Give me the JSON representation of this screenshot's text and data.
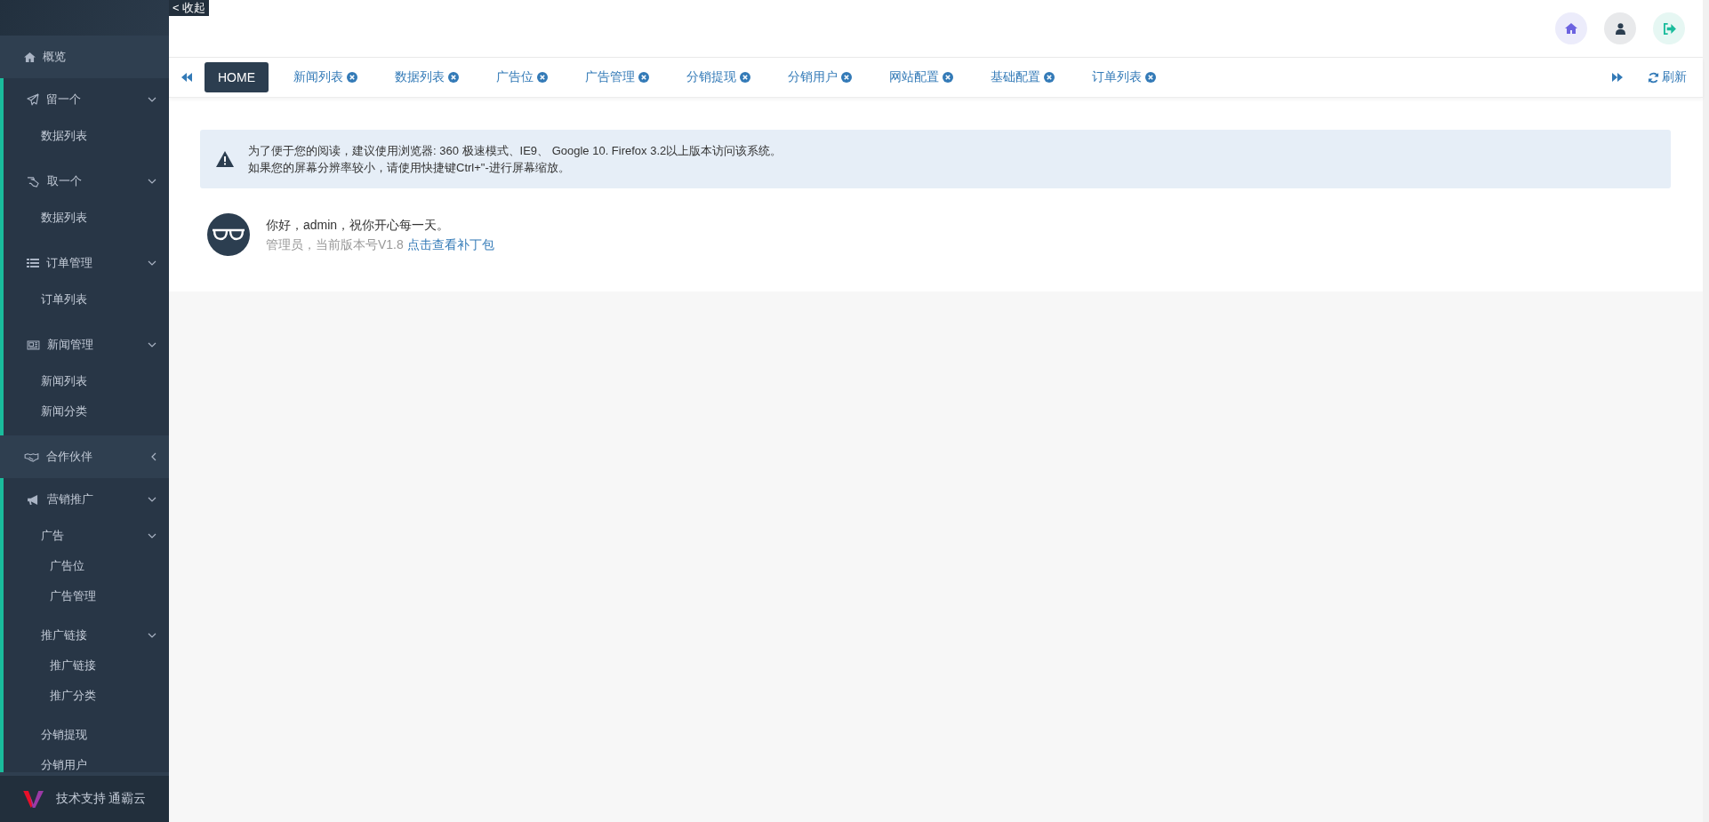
{
  "collapse_button": "< 收起",
  "sidebar": {
    "items": [
      {
        "label": "概览"
      },
      {
        "label": "留一个",
        "expanded": true,
        "children": [
          {
            "label": "数据列表"
          }
        ]
      },
      {
        "label": "取一个",
        "expanded": true,
        "children": [
          {
            "label": "数据列表"
          }
        ]
      },
      {
        "label": "订单管理",
        "expanded": true,
        "children": [
          {
            "label": "订单列表"
          }
        ]
      },
      {
        "label": "新闻管理",
        "expanded": true,
        "children": [
          {
            "label": "新闻列表"
          },
          {
            "label": "新闻分类"
          }
        ]
      },
      {
        "label": "合作伙伴",
        "expanded": false
      },
      {
        "label": "营销推广",
        "expanded": true,
        "children": [
          {
            "label": "广告",
            "expanded": true,
            "children": [
              {
                "label": "广告位"
              },
              {
                "label": "广告管理"
              }
            ]
          },
          {
            "label": "推广链接",
            "expanded": true,
            "children": [
              {
                "label": "推广链接"
              },
              {
                "label": "推广分类"
              }
            ]
          },
          {
            "label": "分销提现"
          },
          {
            "label": "分销用户"
          }
        ]
      }
    ],
    "footer": "技术支持 通霸云"
  },
  "tabs": {
    "items": [
      {
        "label": "HOME",
        "selected": true,
        "closable": false
      },
      {
        "label": "新闻列表",
        "selected": false,
        "closable": true
      },
      {
        "label": "数据列表",
        "selected": false,
        "closable": true
      },
      {
        "label": "广告位",
        "selected": false,
        "closable": true
      },
      {
        "label": "广告管理",
        "selected": false,
        "closable": true
      },
      {
        "label": "分销提现",
        "selected": false,
        "closable": true
      },
      {
        "label": "分销用户",
        "selected": false,
        "closable": true
      },
      {
        "label": "网站配置",
        "selected": false,
        "closable": true
      },
      {
        "label": "基础配置",
        "selected": false,
        "closable": true
      },
      {
        "label": "订单列表",
        "selected": false,
        "closable": true
      }
    ],
    "refresh": "刷新"
  },
  "notice": {
    "lines": [
      "为了便于您的阅读，建议使用浏览器: 360 极速模式、IE9、 Google 10. Firefox 3.2以上版本访问该系统。",
      "如果您的屏幕分辨率较小，请使用快捷键Ctrl+\"-进行屏幕缩放。"
    ]
  },
  "greeting": {
    "title": "你好，admin，祝你开心每一天。",
    "subtitle": "管理员，当前版本号V1.8",
    "link": "点击查看补丁包"
  }
}
